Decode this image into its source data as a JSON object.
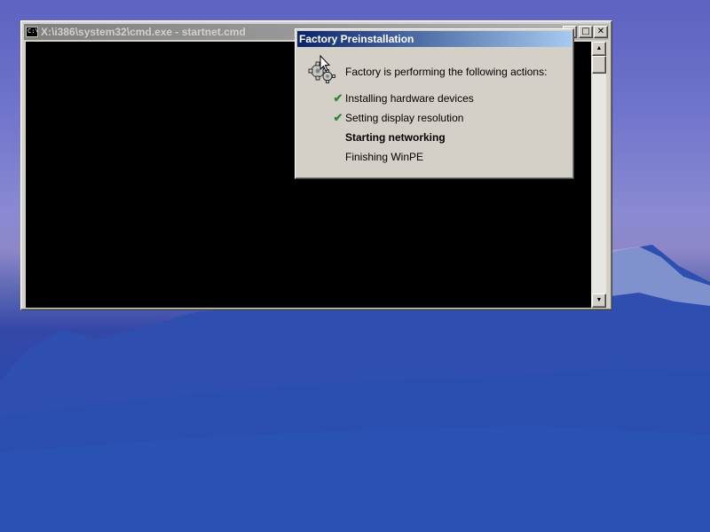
{
  "cmd_window": {
    "icon_text": "C:\\",
    "title": "X:\\i386\\system32\\cmd.exe - startnet.cmd",
    "buttons": {
      "minimize": "_",
      "maximize": "□",
      "close": "✕"
    },
    "scroll_up": "▲",
    "scroll_down": "▼"
  },
  "factory_dialog": {
    "title": "Factory Preinstallation",
    "intro": "Factory is performing the following actions:",
    "actions": [
      {
        "label": "Installing hardware devices",
        "status": "done",
        "mark": "✔"
      },
      {
        "label": "Setting display resolution",
        "status": "done",
        "mark": "✔"
      },
      {
        "label": "Starting networking",
        "status": "current",
        "mark": ""
      },
      {
        "label": "Finishing WinPE",
        "status": "pending",
        "mark": ""
      }
    ],
    "icon": "gear-icon",
    "check_color": "#2e8b2e"
  },
  "colors": {
    "active_title": "#0a246a",
    "inactive_title": "#808080",
    "console_bg": "#000000"
  }
}
